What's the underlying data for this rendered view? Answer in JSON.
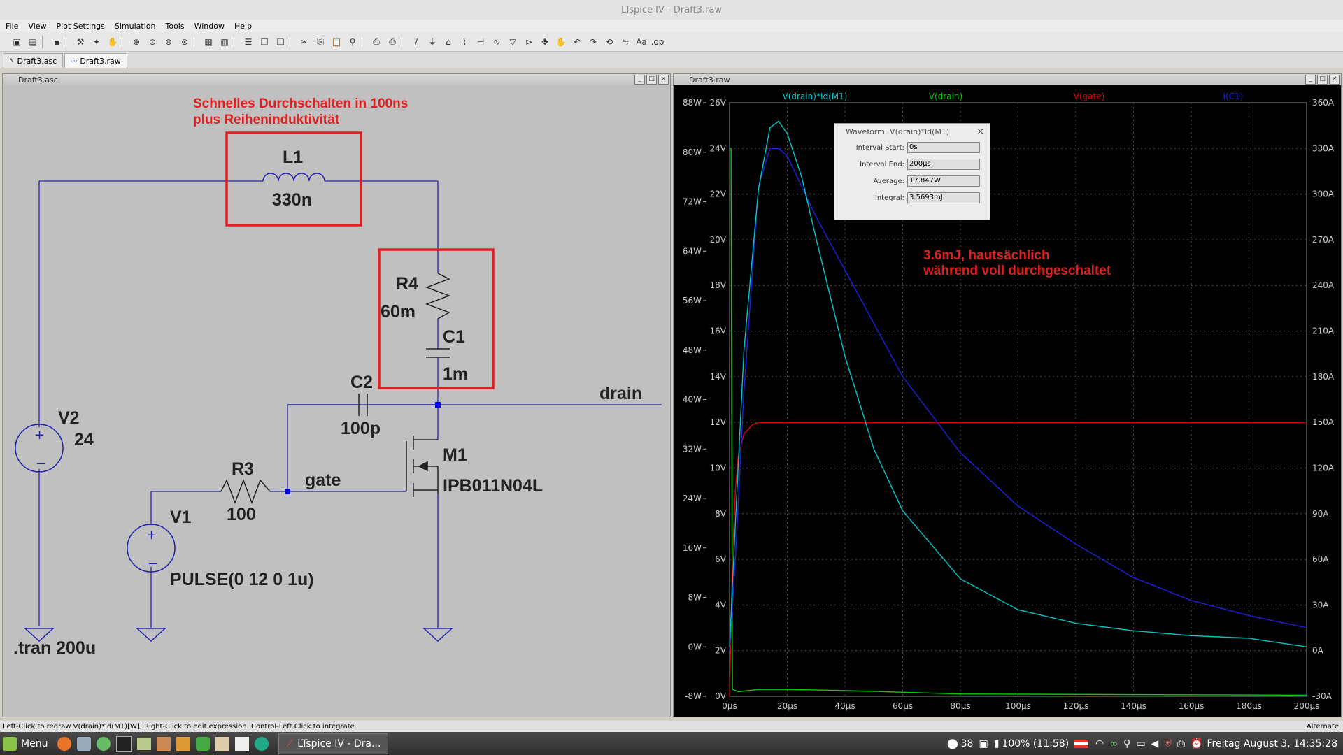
{
  "window": {
    "title": "LTspice IV - Draft3.raw"
  },
  "menu": [
    "File",
    "View",
    "Plot Settings",
    "Simulation",
    "Tools",
    "Window",
    "Help"
  ],
  "tabs": [
    {
      "label": "Draft3.asc"
    },
    {
      "label": "Draft3.raw"
    }
  ],
  "schematic": {
    "title": "Draft3.asc",
    "annotation": [
      "Schnelles Durchschalten in 100ns",
      "plus Reiheninduktivität"
    ],
    "L1": {
      "name": "L1",
      "value": "330n"
    },
    "R4": {
      "name": "R4",
      "value": "60m"
    },
    "C1": {
      "name": "C1",
      "value": "1m"
    },
    "C2": {
      "name": "C2",
      "value": "100p"
    },
    "R3": {
      "name": "R3",
      "value": "100"
    },
    "M1": {
      "name": "M1",
      "value": "IPB011N04L"
    },
    "V2": {
      "name": "V2",
      "value": "24"
    },
    "V1": {
      "name": "V1",
      "value": "PULSE(0 12 0 1u)"
    },
    "net_drain": "drain",
    "net_gate": "gate",
    "directive": ".tran 200u"
  },
  "plot": {
    "title": "Draft3.raw",
    "traces": [
      {
        "name": "V(drain)*Id(M1)",
        "color": "#00c8c8"
      },
      {
        "name": "V(drain)",
        "color": "#00d000"
      },
      {
        "name": "V(gate)",
        "color": "#e00000"
      },
      {
        "name": "I(C1)",
        "color": "#2020e0"
      }
    ],
    "annotation": [
      "3.6mJ, hautsächlich",
      "während voll durchgeschaltet"
    ],
    "waveform": {
      "title": "Waveform: V(drain)*Id(M1)",
      "rows": [
        {
          "label": "Interval Start:",
          "value": "0s"
        },
        {
          "label": "Interval End:",
          "value": "200µs"
        },
        {
          "label": "Average:",
          "value": "17.847W"
        },
        {
          "label": "Integral:",
          "value": "3.5693mJ"
        }
      ]
    }
  },
  "chart_data": {
    "type": "line",
    "x_label": "",
    "x_ticks": [
      "0µs",
      "20µs",
      "40µs",
      "60µs",
      "80µs",
      "100µs",
      "120µs",
      "140µs",
      "160µs",
      "180µs",
      "200µs"
    ],
    "xlim": [
      0,
      200
    ],
    "y_axes": {
      "power_ticks": [
        "88W",
        "80W",
        "72W",
        "64W",
        "56W",
        "48W",
        "40W",
        "32W",
        "24W",
        "16W",
        "8W",
        "0W",
        "-8W"
      ],
      "voltage_ticks": [
        "26V",
        "24V",
        "22V",
        "20V",
        "18V",
        "16V",
        "14V",
        "12V",
        "10V",
        "8V",
        "6V",
        "4V",
        "2V",
        "0V"
      ],
      "current_ticks": [
        "360A",
        "330A",
        "300A",
        "270A",
        "240A",
        "210A",
        "180A",
        "150A",
        "120A",
        "90A",
        "60A",
        "30A",
        "0A",
        "-30A"
      ]
    },
    "series": [
      {
        "name": "V(drain)*Id(M1)",
        "unit": "W",
        "x": [
          0,
          2,
          5,
          10,
          14,
          17,
          20,
          25,
          30,
          40,
          50,
          60,
          80,
          100,
          120,
          140,
          160,
          180,
          200
        ],
        "values": [
          0,
          20,
          48,
          74,
          84,
          85,
          83,
          76,
          66,
          47,
          32,
          22,
          11,
          6,
          3.8,
          2.6,
          1.8,
          1.4,
          0
        ]
      },
      {
        "name": "I(C1)",
        "unit": "A",
        "x": [
          0,
          2,
          5,
          10,
          14,
          17,
          20,
          30,
          40,
          60,
          80,
          100,
          120,
          140,
          160,
          180,
          200
        ],
        "values": [
          0,
          60,
          170,
          305,
          330,
          330,
          325,
          285,
          250,
          180,
          130,
          95,
          70,
          48,
          33,
          23,
          15
        ]
      },
      {
        "name": "V(gate)",
        "unit": "V",
        "x": [
          0,
          1,
          2,
          3,
          5,
          8,
          10,
          15,
          200
        ],
        "values": [
          0,
          6,
          9,
          10.5,
          11.5,
          11.9,
          12,
          12,
          12
        ]
      },
      {
        "name": "V(drain)",
        "unit": "V",
        "x": [
          0,
          0.5,
          1,
          3,
          10,
          20,
          40,
          80,
          200
        ],
        "values": [
          24,
          24,
          0.3,
          0.2,
          0.3,
          0.3,
          0.25,
          0.1,
          0.05
        ]
      }
    ]
  },
  "status": "Left-Click to redraw V(drain)*Id(M1)[W],  Right-Click to edit expression. Control-Left Click to integrate",
  "status_right": "Alternate",
  "taskbar": {
    "menu_label": "Menu",
    "task": "LTspice IV - Dra...",
    "tray_count": "38",
    "battery": "100% (11:58)",
    "clock": "Freitag August  3, 14:35:28"
  }
}
